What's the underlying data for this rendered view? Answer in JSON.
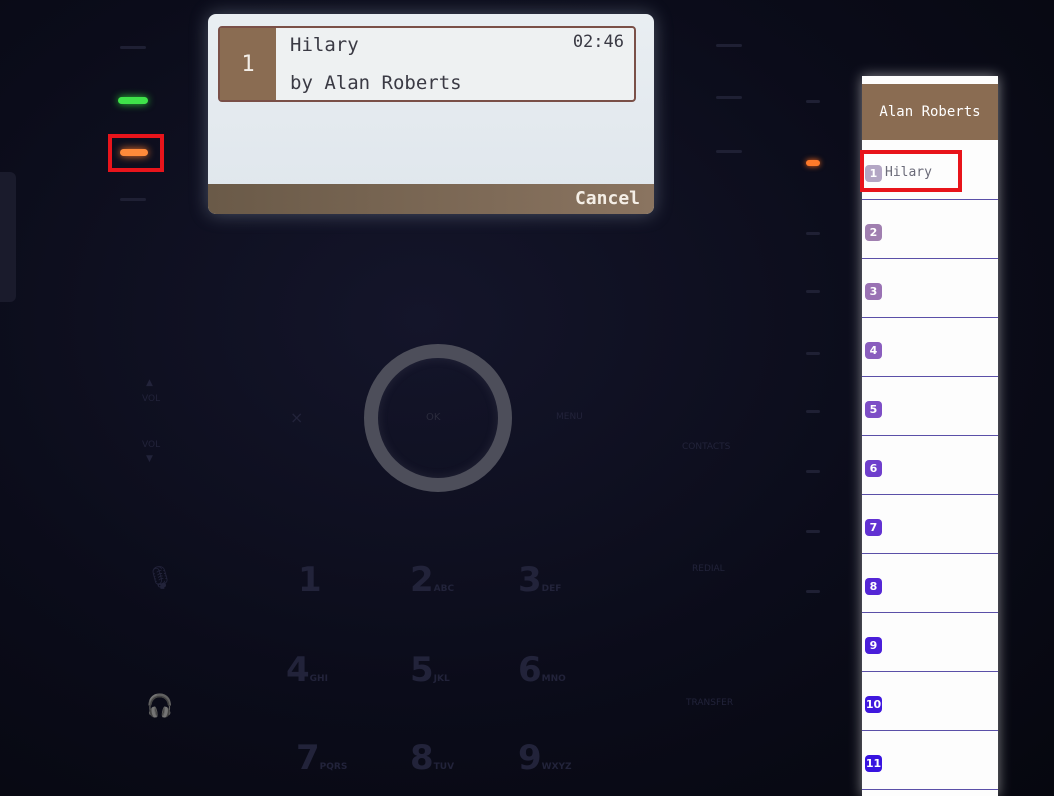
{
  "lcd": {
    "index": "1",
    "title": "Hilary",
    "subtitle": "by Alan Roberts",
    "time": "02:46",
    "softkey": "Cancel"
  },
  "keypad": {
    "close": "×",
    "ok": "OK",
    "menu": "MENU",
    "vol_up": "VOL",
    "vol_down": "VOL",
    "contacts": "CONTACTS",
    "redial": "REDIAL",
    "transfer": "TRANSFER",
    "keys": [
      {
        "digit": "1",
        "letters": ""
      },
      {
        "digit": "2",
        "letters": "ABC"
      },
      {
        "digit": "3",
        "letters": "DEF"
      },
      {
        "digit": "4",
        "letters": "GHI"
      },
      {
        "digit": "5",
        "letters": "JKL"
      },
      {
        "digit": "6",
        "letters": "MNO"
      },
      {
        "digit": "7",
        "letters": "PQRS"
      },
      {
        "digit": "8",
        "letters": "TUV"
      },
      {
        "digit": "9",
        "letters": "WXYZ"
      }
    ]
  },
  "panel": {
    "header": "Alan Roberts",
    "rows": [
      {
        "num": "1",
        "label": "Hilary",
        "color": "#b3a6c4"
      },
      {
        "num": "2",
        "label": "",
        "color": "#a07fb0"
      },
      {
        "num": "3",
        "label": "",
        "color": "#9a72b4"
      },
      {
        "num": "4",
        "label": "",
        "color": "#8a5ebe"
      },
      {
        "num": "5",
        "label": "",
        "color": "#7d4ec6"
      },
      {
        "num": "6",
        "label": "",
        "color": "#6f3fcc"
      },
      {
        "num": "7",
        "label": "",
        "color": "#6232d2"
      },
      {
        "num": "8",
        "label": "",
        "color": "#5527d6"
      },
      {
        "num": "9",
        "label": "",
        "color": "#4a1fda"
      },
      {
        "num": "10",
        "label": "",
        "color": "#4018de"
      },
      {
        "num": "11",
        "label": "",
        "color": "#3813e0"
      }
    ]
  },
  "colors": {
    "highlight": "#e8141b",
    "led_green": "#3fe34a",
    "led_orange": "#ff8a3a"
  }
}
